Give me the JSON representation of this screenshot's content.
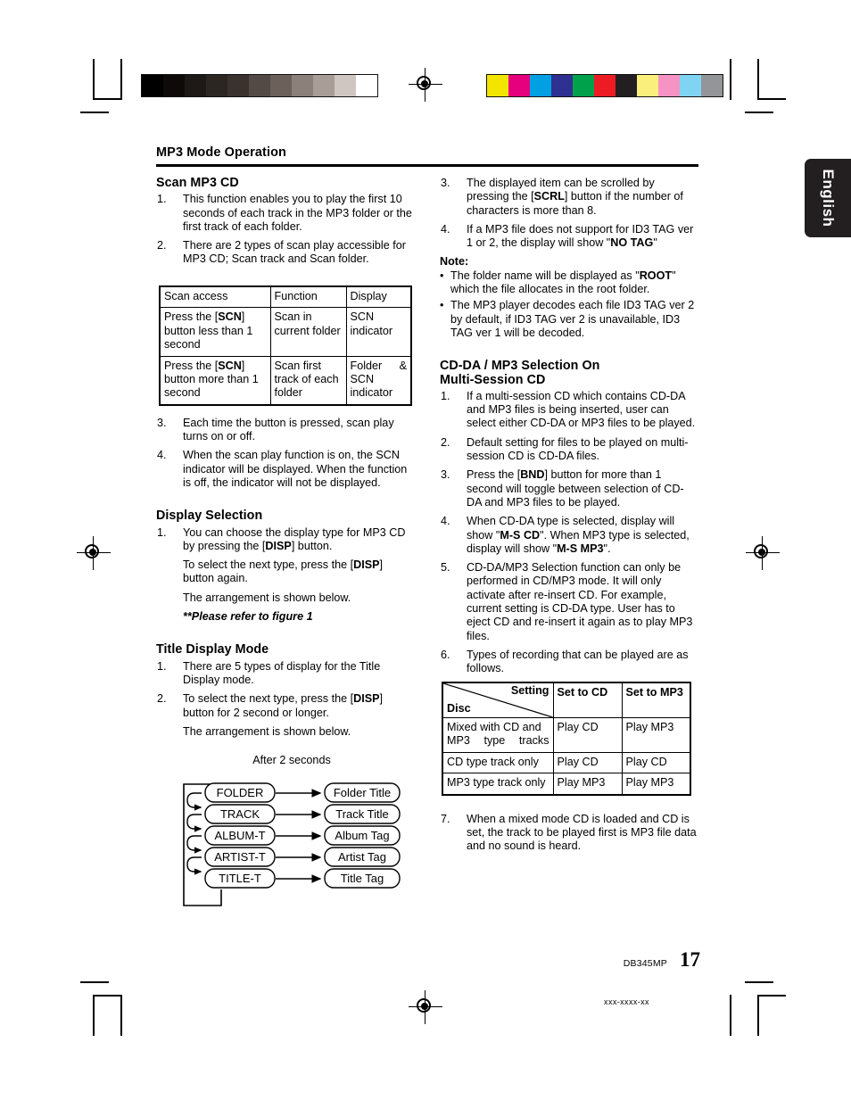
{
  "header": {
    "title": "MP3 Mode Operation"
  },
  "language_tab": {
    "label": "English"
  },
  "left_column": {
    "scan_section": {
      "heading": "Scan MP3 CD",
      "items": [
        {
          "n": "1.",
          "text": "This function enables you to play the first 10 seconds of each track in the MP3 folder or the first track of each folder."
        },
        {
          "n": "2.",
          "text": "There are 2 types of scan play accessible for MP3 CD; Scan track and Scan folder."
        }
      ],
      "items_after_table": [
        {
          "n": "3.",
          "text": "Each time the button is pressed, scan play turns on or off."
        },
        {
          "n": "4.",
          "text": "When the scan play function is on, the SCN indicator will be displayed. When the function is off, the indicator will not be displayed."
        }
      ]
    },
    "display_section": {
      "heading": "Display Selection",
      "item1_n": "1.",
      "item1_a": "You can choose the display type for MP3 CD by pressing the [",
      "item1_b": "DISP",
      "item1_c": "] button.",
      "item1_line2_a": "To select the next type, press the [",
      "item1_line2_b": "DISP",
      "item1_line2_c": "] button again.",
      "item1_line3": "The arrangement is shown below.",
      "figure_note": "**Please refer to figure 1"
    },
    "title_display_section": {
      "heading": "Title Display Mode",
      "item1_n": "1.",
      "item1": "There are 5 types of display for the Title Display mode.",
      "item2_n": "2.",
      "item2_a": "To select the next type, press the [",
      "item2_b": "DISP",
      "item2_c": "] button for 2 second or longer.",
      "item2_line2": "The arrangement is shown below."
    }
  },
  "right_column": {
    "top_items": [
      {
        "n": "3.",
        "a": "The displayed item can be scrolled by pressing the [",
        "b": "SCRL",
        "c": "] button if the number of characters is more than 8."
      },
      {
        "n": "4.",
        "a": "If a MP3 file does not support for ID3 TAG ver 1 or 2, the display will show \"",
        "b": "NO TAG",
        "c": "\""
      }
    ],
    "note_label": "Note:",
    "notes": [
      {
        "a": "The folder name will be displayed as \"",
        "b": "ROOT",
        "c": "\" which the file allocates in the root folder."
      },
      {
        "a": "The MP3 player decodes each file ID3 TAG ver 2 by default, if ID3 TAG ver 2 is unavailable, ID3 TAG ver 1 will be decoded.",
        "b": "",
        "c": ""
      }
    ],
    "cdda_section": {
      "heading_line1": "CD-DA / MP3 Selection On",
      "heading_line2": "Multi-Session CD",
      "items": [
        {
          "n": "1.",
          "a": "If a multi-session CD which contains CD-DA and MP3 files is being inserted, user can select either CD-DA or MP3 files to be played.",
          "b": "",
          "c": ""
        },
        {
          "n": "2.",
          "a": "Default setting for files to be played on multi-session CD is CD-DA files.",
          "b": "",
          "c": ""
        },
        {
          "n": "3.",
          "a": "Press the [",
          "b": "BND",
          "c": "] button for more than 1 second will toggle between selection of CD-DA and MP3 files to be played."
        },
        {
          "n": "4.",
          "a": "When CD-DA type is selected, display will show \"",
          "b": "M-S CD",
          "c": "\". When MP3 type is selected, display will show \"",
          "d": "M-S MP3",
          "e": "\"."
        },
        {
          "n": "5.",
          "a": "CD-DA/MP3 Selection function can only be performed in CD/MP3 mode. It will only activate after re-insert CD. For example, current setting is CD-DA type. User has to eject CD and re-insert it again as to play MP3 files.",
          "b": "",
          "c": ""
        },
        {
          "n": "6.",
          "a": "Types of recording that can be played are as follows.",
          "b": "",
          "c": ""
        }
      ],
      "item_after_table": {
        "n": "7.",
        "text": "When a mixed mode CD is loaded and CD is set, the track to be played first is MP3 file data and no sound is heard."
      }
    }
  },
  "scan_table": {
    "headers": [
      "Scan access",
      "Function",
      "Display"
    ],
    "rows": [
      {
        "access_a": "Press the [",
        "access_b": "SCN",
        "access_c": "] button less than 1 second",
        "function": "Scan in current folder",
        "display": "SCN indicator"
      },
      {
        "access_a": "Press the [",
        "access_b": "SCN",
        "access_c": "] button more than 1 second",
        "function": "Scan first track of each folder",
        "display_a": "Folder &",
        "display_b": "SCN",
        "display_c": "indicator"
      }
    ]
  },
  "setting_table": {
    "corner_setting": "Setting",
    "corner_disc": "Disc",
    "headers": [
      "Set to CD",
      "Set to MP3"
    ],
    "rows": [
      {
        "disc": "Mixed with CD and MP3 type tracks",
        "cd": "Play CD",
        "mp3": "Play MP3"
      },
      {
        "disc": "CD type track only",
        "cd": "Play CD",
        "mp3": "Play CD"
      },
      {
        "disc": "MP3 type track only",
        "cd": "Play MP3",
        "mp3": "Play MP3"
      }
    ]
  },
  "flow_diagram": {
    "caption": "After 2 seconds",
    "left_nodes": [
      "FOLDER",
      "TRACK",
      "ALBUM-T",
      "ARTIST-T",
      "TITLE-T"
    ],
    "right_nodes": [
      "Folder Title",
      "Track Title",
      "Album Tag",
      "Artist Tag",
      "Title Tag"
    ]
  },
  "footer": {
    "model": "DB345MP",
    "page_number": "17",
    "doc_id": "xxx-xxxx-xx"
  },
  "calibration": {
    "gray_swatches": [
      "#000000",
      "#0d0a09",
      "#1d1917",
      "#2c2623",
      "#3a322e",
      "#544a45",
      "#6b605a",
      "#8b807a",
      "#a89d97",
      "#cfc6c1",
      "#ffffff"
    ],
    "color_swatches": [
      "#f3e500",
      "#e6007e",
      "#00a0e2",
      "#2e3192",
      "#00a14b",
      "#ed1c24",
      "#231f20",
      "#faee7d",
      "#f493c4",
      "#7fd4f4",
      "#939598"
    ]
  }
}
